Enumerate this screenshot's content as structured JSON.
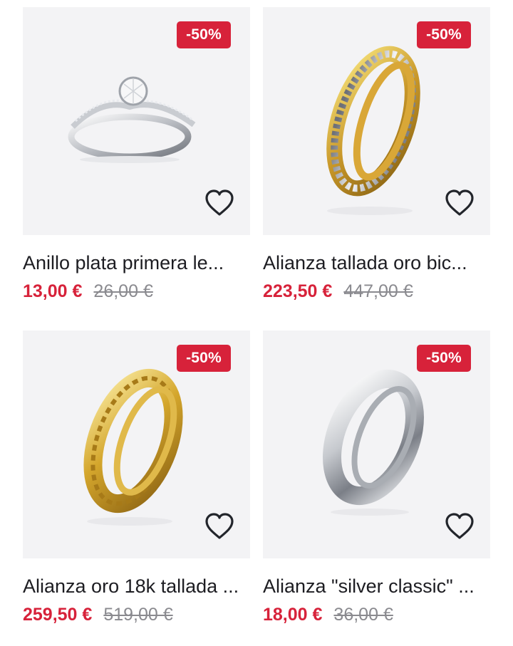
{
  "products": [
    {
      "title": "Anillo plata primera le...",
      "discount": "-50%",
      "price_now": "13,00 €",
      "price_old": "26,00 €",
      "image": "silver-solitaire-ring",
      "icon": "heart-outline-icon"
    },
    {
      "title": "Alianza tallada oro bic...",
      "discount": "-50%",
      "price_now": "223,50 €",
      "price_old": "447,00 €",
      "image": "two-tone-gold-band-ring",
      "icon": "heart-outline-icon"
    },
    {
      "title": "Alianza oro 18k tallada ...",
      "discount": "-50%",
      "price_now": "259,50 €",
      "price_old": "519,00 €",
      "image": "gold-greek-key-band-ring",
      "icon": "heart-outline-icon"
    },
    {
      "title": "Alianza \"silver classic\" ...",
      "discount": "-50%",
      "price_now": "18,00 €",
      "price_old": "36,00 €",
      "image": "silver-classic-band-ring",
      "icon": "heart-outline-icon"
    }
  ],
  "colors": {
    "accent": "#d7223a",
    "image_background": "#f3f3f5",
    "title_text": "#1d1d22",
    "old_price": "#8a8a8f"
  }
}
